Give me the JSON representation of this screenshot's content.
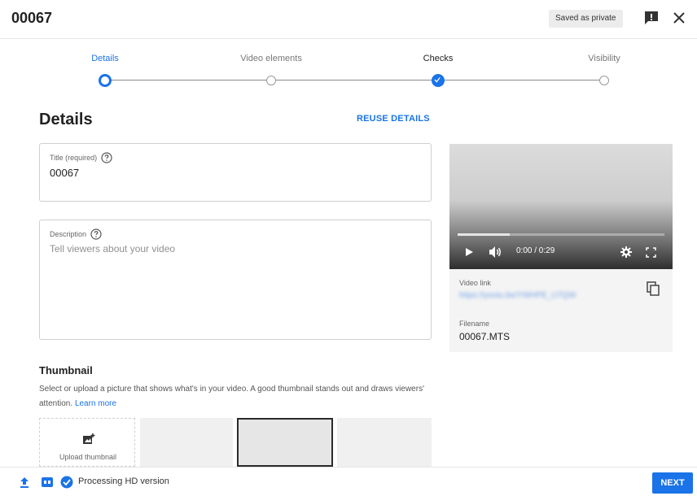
{
  "header": {
    "title": "00067",
    "saved_badge": "Saved as private"
  },
  "stepper": {
    "steps": [
      {
        "label": "Details",
        "state": "active"
      },
      {
        "label": "Video elements",
        "state": "pending"
      },
      {
        "label": "Checks",
        "state": "done"
      },
      {
        "label": "Visibility",
        "state": "pending"
      }
    ]
  },
  "details": {
    "heading": "Details",
    "reuse_label": "REUSE DETAILS",
    "title_field": {
      "label": "Title (required)",
      "value": "00067"
    },
    "description_field": {
      "label": "Description",
      "placeholder": "Tell viewers about your video"
    }
  },
  "thumbnail": {
    "heading": "Thumbnail",
    "description": "Select or upload a picture that shows what's in your video. A good thumbnail stands out and draws viewers' attention.",
    "learn_more": "Learn more",
    "upload_label": "Upload thumbnail"
  },
  "preview": {
    "time": "0:00 / 0:29",
    "progress": 0.25,
    "video_link_label": "Video link",
    "video_link": "https://youtu.be/YWHPE_U7QW",
    "filename_label": "Filename",
    "filename": "00067.MTS"
  },
  "footer": {
    "status": "Processing HD version",
    "next_label": "NEXT"
  },
  "colors": {
    "accent": "#1a73e8"
  }
}
